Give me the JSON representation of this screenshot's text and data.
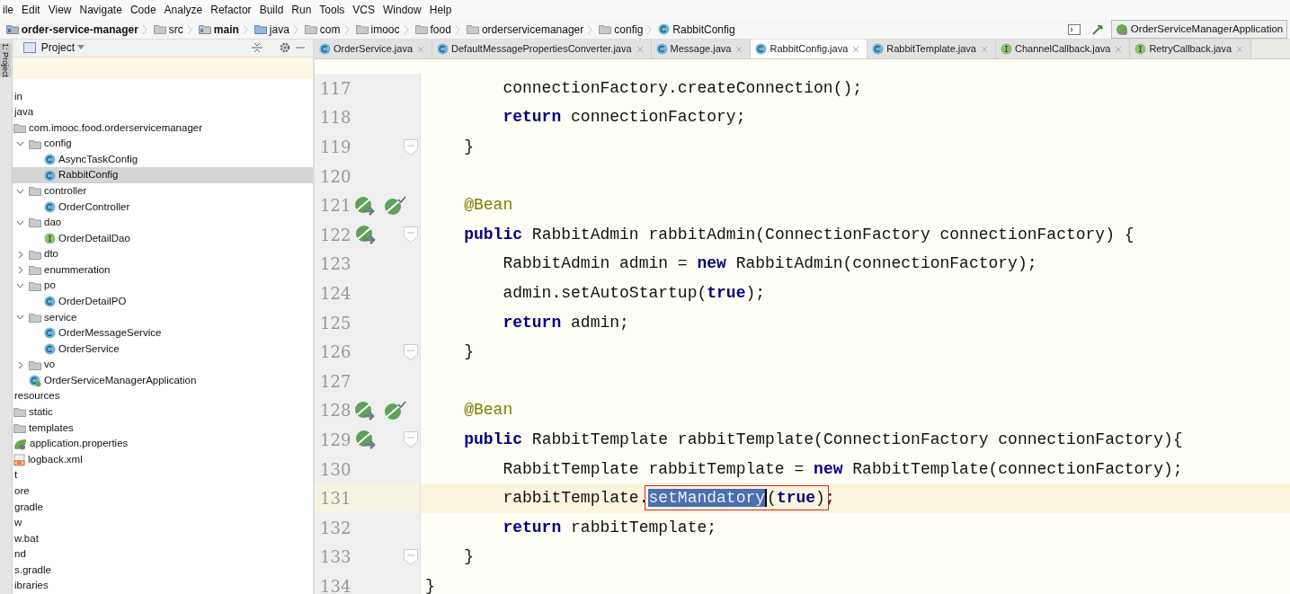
{
  "menu": [
    "ile",
    "Edit",
    "View",
    "Navigate",
    "Code",
    "Analyze",
    "Refactor",
    "Build",
    "Run",
    "Tools",
    "VCS",
    "Window",
    "Help"
  ],
  "breadcrumbs": [
    {
      "label": "order-service-manager",
      "kind": "module",
      "bold": true
    },
    {
      "label": "src",
      "kind": "folder",
      "bold": false
    },
    {
      "label": "main",
      "kind": "source",
      "bold": true
    },
    {
      "label": "java",
      "kind": "java",
      "bold": false
    },
    {
      "label": "com",
      "kind": "folder",
      "bold": false
    },
    {
      "label": "imooc",
      "kind": "folder",
      "bold": false
    },
    {
      "label": "food",
      "kind": "folder",
      "bold": false
    },
    {
      "label": "orderservicemanager",
      "kind": "folder",
      "bold": false
    },
    {
      "label": "config",
      "kind": "folder",
      "bold": false
    },
    {
      "label": "RabbitConfig",
      "kind": "class",
      "bold": false
    }
  ],
  "run_config": "OrderServiceManagerApplication",
  "side_strip": "1: Project",
  "project_panel": {
    "title": "Project",
    "tree": [
      {
        "label": "in",
        "selected": false
      },
      {
        "label": "java",
        "selected": false,
        "children": [
          {
            "label": "com.imooc.food.orderservicemanager",
            "kind": "folder",
            "selected": false,
            "children": [
              {
                "label": "config",
                "kind": "folder",
                "expanded": true,
                "selected": false,
                "children": [
                  {
                    "label": "AsyncTaskConfig",
                    "kind": "class",
                    "selected": false
                  },
                  {
                    "label": "RabbitConfig",
                    "kind": "class",
                    "selected": true
                  }
                ]
              },
              {
                "label": "controller",
                "kind": "folder",
                "expanded": true,
                "selected": false,
                "children": [
                  {
                    "label": "OrderController",
                    "kind": "class",
                    "selected": false
                  }
                ]
              },
              {
                "label": "dao",
                "kind": "folder",
                "expanded": true,
                "selected": false,
                "children": [
                  {
                    "label": "OrderDetailDao",
                    "kind": "interface",
                    "selected": false
                  }
                ]
              },
              {
                "label": "dto",
                "kind": "folder",
                "expanded": false,
                "selected": false
              },
              {
                "label": "enummeration",
                "kind": "folder",
                "expanded": false,
                "selected": false
              },
              {
                "label": "po",
                "kind": "folder",
                "expanded": true,
                "selected": false,
                "children": [
                  {
                    "label": "OrderDetailPO",
                    "kind": "class",
                    "selected": false
                  }
                ]
              },
              {
                "label": "service",
                "kind": "folder",
                "expanded": true,
                "selected": false,
                "children": [
                  {
                    "label": "OrderMessageService",
                    "kind": "class",
                    "selected": false
                  },
                  {
                    "label": "OrderService",
                    "kind": "class",
                    "selected": false
                  }
                ]
              },
              {
                "label": "vo",
                "kind": "folder",
                "expanded": false,
                "selected": false
              },
              {
                "label": "OrderServiceManagerApplication",
                "kind": "app",
                "selected": false
              }
            ]
          }
        ]
      },
      {
        "label": "resources",
        "selected": false,
        "children": [
          {
            "label": "static",
            "kind": "folder",
            "selected": false
          },
          {
            "label": "templates",
            "kind": "folder",
            "selected": false
          },
          {
            "label": "application.properties",
            "kind": "properties",
            "selected": false
          },
          {
            "label": "logback.xml",
            "kind": "xml",
            "selected": false
          }
        ]
      },
      {
        "label": "t",
        "selected": false
      },
      {
        "label": "ore",
        "selected": false
      },
      {
        "label": "gradle",
        "selected": false
      },
      {
        "label": "w",
        "selected": false
      },
      {
        "label": "w.bat",
        "selected": false
      },
      {
        "label": "nd",
        "selected": false
      },
      {
        "label": "s.gradle",
        "selected": false
      },
      {
        "label": "ibraries",
        "selected": false
      }
    ]
  },
  "tabs": [
    {
      "label": "OrderService.java",
      "kind": "class",
      "selected": false
    },
    {
      "label": "DefaultMessagePropertiesConverter.java",
      "kind": "class",
      "selected": false
    },
    {
      "label": "Message.java",
      "kind": "class",
      "selected": false
    },
    {
      "label": "RabbitConfig.java",
      "kind": "class",
      "selected": true
    },
    {
      "label": "RabbitTemplate.java",
      "kind": "class",
      "selected": false
    },
    {
      "label": "ChannelCallback.java",
      "kind": "interface",
      "selected": false
    },
    {
      "label": "RetryCallback.java",
      "kind": "interface",
      "selected": false
    }
  ],
  "code": [
    {
      "number": "117",
      "current": false,
      "fold": false,
      "bean_nav": false,
      "bean_check": false,
      "segments": [
        {
          "text": "        connectionFactory.createConnection();",
          "kind": "plain"
        }
      ]
    },
    {
      "number": "118",
      "current": false,
      "fold": false,
      "bean_nav": false,
      "bean_check": false,
      "segments": [
        {
          "text": "        return",
          "kind": "keyword"
        },
        {
          "text": " connectionFactory;",
          "kind": "plain"
        }
      ]
    },
    {
      "number": "119",
      "current": false,
      "fold": true,
      "bean_nav": false,
      "bean_check": false,
      "segments": [
        {
          "text": "    }",
          "kind": "plain"
        }
      ]
    },
    {
      "number": "120",
      "current": false,
      "fold": false,
      "bean_nav": false,
      "bean_check": false
    },
    {
      "number": "121",
      "current": false,
      "fold": false,
      "bean_nav": true,
      "bean_check": true,
      "segments": [
        {
          "text": "    @Bean",
          "kind": "annotation"
        }
      ]
    },
    {
      "number": "122",
      "current": false,
      "fold": true,
      "bean_nav": true,
      "bean_check": false,
      "segments": [
        {
          "text": "    public",
          "kind": "keyword"
        },
        {
          "text": " RabbitAdmin rabbitAdmin(ConnectionFactory connectionFactory) {",
          "kind": "plain"
        }
      ]
    },
    {
      "number": "123",
      "current": false,
      "fold": false,
      "bean_nav": false,
      "bean_check": false,
      "segments": [
        {
          "text": "        RabbitAdmin admin = ",
          "kind": "plain"
        },
        {
          "text": "new",
          "kind": "keyword"
        },
        {
          "text": " RabbitAdmin(connectionFactory);",
          "kind": "plain"
        }
      ]
    },
    {
      "number": "124",
      "current": false,
      "fold": false,
      "bean_nav": false,
      "bean_check": false,
      "segments": [
        {
          "text": "        admin.setAutoStartup(",
          "kind": "plain"
        },
        {
          "text": "true",
          "kind": "keyword"
        },
        {
          "text": ");",
          "kind": "plain"
        }
      ]
    },
    {
      "number": "125",
      "current": false,
      "fold": false,
      "bean_nav": false,
      "bean_check": false,
      "segments": [
        {
          "text": "        return",
          "kind": "keyword"
        },
        {
          "text": " admin;",
          "kind": "plain"
        }
      ]
    },
    {
      "number": "126",
      "current": false,
      "fold": true,
      "bean_nav": false,
      "bean_check": false,
      "segments": [
        {
          "text": "    }",
          "kind": "plain"
        }
      ]
    },
    {
      "number": "127",
      "current": false,
      "fold": false,
      "bean_nav": false,
      "bean_check": false
    },
    {
      "number": "128",
      "current": false,
      "fold": false,
      "bean_nav": true,
      "bean_check": true,
      "segments": [
        {
          "text": "    @Bean",
          "kind": "annotation"
        }
      ]
    },
    {
      "number": "129",
      "current": false,
      "fold": true,
      "bean_nav": true,
      "bean_check": false,
      "segments": [
        {
          "text": "    public",
          "kind": "keyword"
        },
        {
          "text": " RabbitTemplate rabbitTemplate(ConnectionFactory connectionFactory){",
          "kind": "plain"
        }
      ]
    },
    {
      "number": "130",
      "current": false,
      "fold": false,
      "bean_nav": false,
      "bean_check": false,
      "segments": [
        {
          "text": "        RabbitTemplate rabbitTemplate = ",
          "kind": "plain"
        },
        {
          "text": "new",
          "kind": "keyword"
        },
        {
          "text": " RabbitTemplate(connectionFactory);",
          "kind": "plain"
        }
      ]
    },
    {
      "number": "131",
      "current": true,
      "fold": false,
      "bean_nav": false,
      "bean_check": false,
      "segments": [
        {
          "text": "        rabbitTemplate.",
          "kind": "plain"
        },
        {
          "text": "setMandatory",
          "kind": "selected",
          "boxed": true
        },
        {
          "text": "(",
          "kind": "plain",
          "boxed": true
        },
        {
          "text": "true",
          "kind": "keyword",
          "boxed": true
        },
        {
          "text": ")",
          "kind": "plain",
          "boxed": true
        },
        {
          "text": ";",
          "kind": "plain"
        }
      ]
    },
    {
      "number": "132",
      "current": false,
      "fold": false,
      "bean_nav": false,
      "bean_check": false,
      "segments": [
        {
          "text": "        return",
          "kind": "keyword"
        },
        {
          "text": " rabbitTemplate;",
          "kind": "plain"
        }
      ]
    },
    {
      "number": "133",
      "current": false,
      "fold": true,
      "bean_nav": false,
      "bean_check": false,
      "segments": [
        {
          "text": "    }",
          "kind": "plain"
        }
      ]
    },
    {
      "number": "134",
      "current": false,
      "fold": false,
      "bean_nav": false,
      "bean_check": false,
      "segments": [
        {
          "text": "}",
          "kind": "plain"
        }
      ]
    }
  ]
}
